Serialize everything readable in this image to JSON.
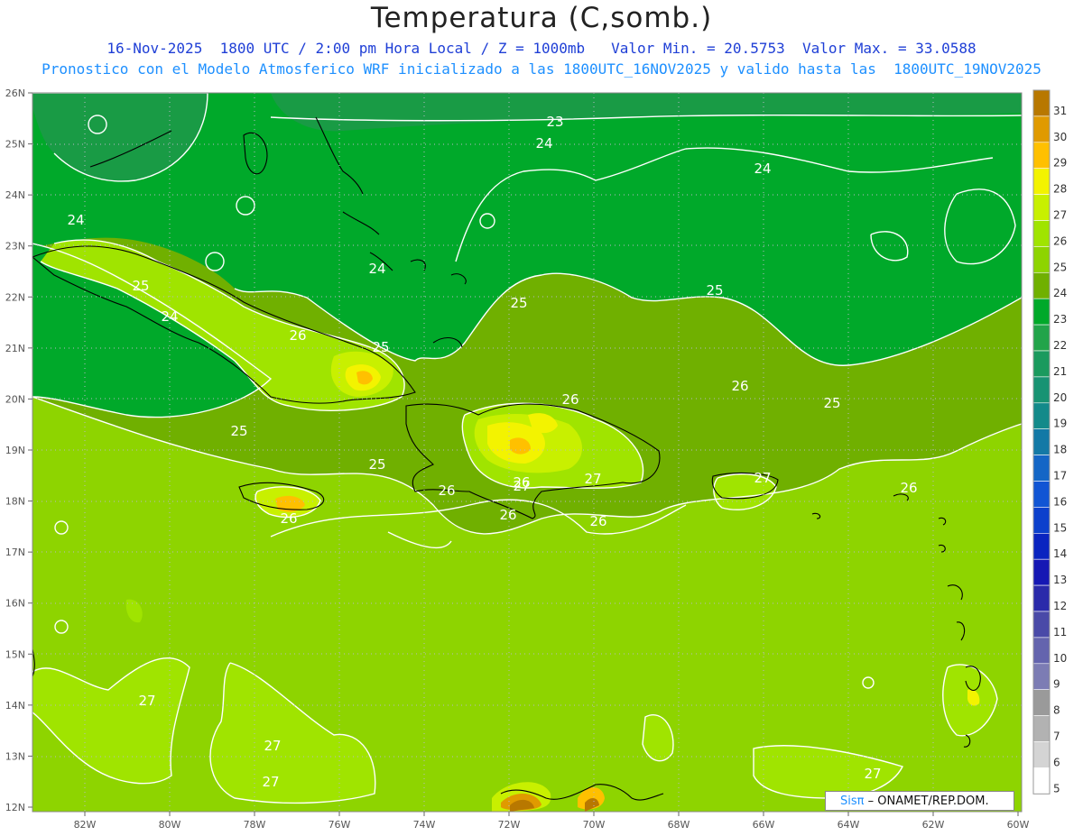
{
  "header": {
    "title": "Temperatura (C,somb.)",
    "subtitle1": "16-Nov-2025  1800 UTC / 2:00 pm Hora Local / Z = 1000mb   Valor Min. = 20.5753  Valor Max. = 33.0588",
    "subtitle2": "Pronostico con el Modelo Atmosferico WRF inicializado a las 1800UTC_16NOV2025 y valido hasta las  1800UTC_19NOV2025"
  },
  "map": {
    "lat_ticks": [
      "26N",
      "25N",
      "24N",
      "23N",
      "22N",
      "21N",
      "20N",
      "19N",
      "18N",
      "17N",
      "16N",
      "15N",
      "14N",
      "13N",
      "12N"
    ],
    "lon_ticks": [
      "82W",
      "80W",
      "78W",
      "76W",
      "74W",
      "72W",
      "70W",
      "68W",
      "66W",
      "64W",
      "62W",
      "60W"
    ],
    "contour_labels": [
      "23",
      "24",
      "24",
      "24",
      "24",
      "25",
      "25",
      "24",
      "25",
      "25",
      "26",
      "25",
      "26",
      "26",
      "25",
      "25",
      "26",
      "26",
      "26",
      "27",
      "26",
      "27",
      "26",
      "26",
      "27",
      "27",
      "27",
      "27",
      "27"
    ]
  },
  "colorbar": {
    "labels": [
      "31",
      "30",
      "29",
      "28",
      "27",
      "26",
      "25",
      "24",
      "23",
      "22",
      "21",
      "20",
      "19",
      "18",
      "17",
      "16",
      "15",
      "14",
      "13",
      "12",
      "11",
      "10",
      "9",
      "8",
      "7",
      "6",
      "5"
    ],
    "colors": [
      "#b87800",
      "#e09a00",
      "#ffc000",
      "#f3f300",
      "#c8f000",
      "#a0e400",
      "#8ed400",
      "#70b000",
      "#00a92a",
      "#22a44a",
      "#1a9a5e",
      "#189373",
      "#138a8a",
      "#1379a6",
      "#1466c6",
      "#1155d4",
      "#0c40cc",
      "#0a24c0",
      "#1618b4",
      "#2a2aaa",
      "#4a4aa8",
      "#6464ae",
      "#7c7cb4",
      "#9a9a9a",
      "#b2b2b2",
      "#d4d4d4",
      "#ffffff"
    ]
  },
  "credit": {
    "brand": "Sisπ",
    "org": " –  ONAMET/REP.DOM."
  }
}
